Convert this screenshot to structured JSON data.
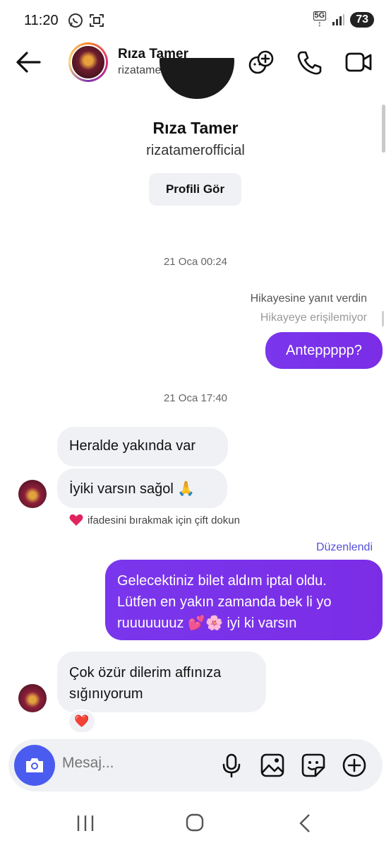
{
  "status_bar": {
    "time": "11:20",
    "network": "5G",
    "battery": "73"
  },
  "header": {
    "name": "Rıza Tamer",
    "username": "rizatamerofficial"
  },
  "profile": {
    "name": "Rıza Tamer",
    "username": "rizatamerofficial",
    "view_profile_label": "Profili Gör"
  },
  "conversation": {
    "timestamp_1": "21 Oca 00:24",
    "story_reply_note": "Hikayesine yanıt verdin",
    "story_unavailable": "Hikayeye erişilemiyor",
    "msg_out_1": "Anteppppp?",
    "timestamp_2": "21 Oca 17:40",
    "msg_in_1": "Heralde yakında var",
    "msg_in_2": "İyiki varsın sağol 🙏",
    "like_hint": "ifadesini bırakmak için çift dokun",
    "edited_label": "Düzenlendi",
    "msg_out_2_line1": "Gelecektiniz bilet aldım iptal oldu.",
    "msg_out_2_line2": "Lütfen en yakın zamanda bek li yo",
    "msg_out_2_line3": "ruuuuuuuz 💕🌸 iyi ki varsın",
    "msg_in_3_line1": "Çok özür dilerim affınıza",
    "msg_in_3_line2": "sığınıyorum",
    "reaction": "❤️"
  },
  "composer": {
    "placeholder": "Mesaj..."
  },
  "colors": {
    "outgoing_bubble": "#7b2de6",
    "incoming_bubble": "#eff1f4",
    "camera_button": "#4a5cf0",
    "edited_link": "#5551d8"
  }
}
